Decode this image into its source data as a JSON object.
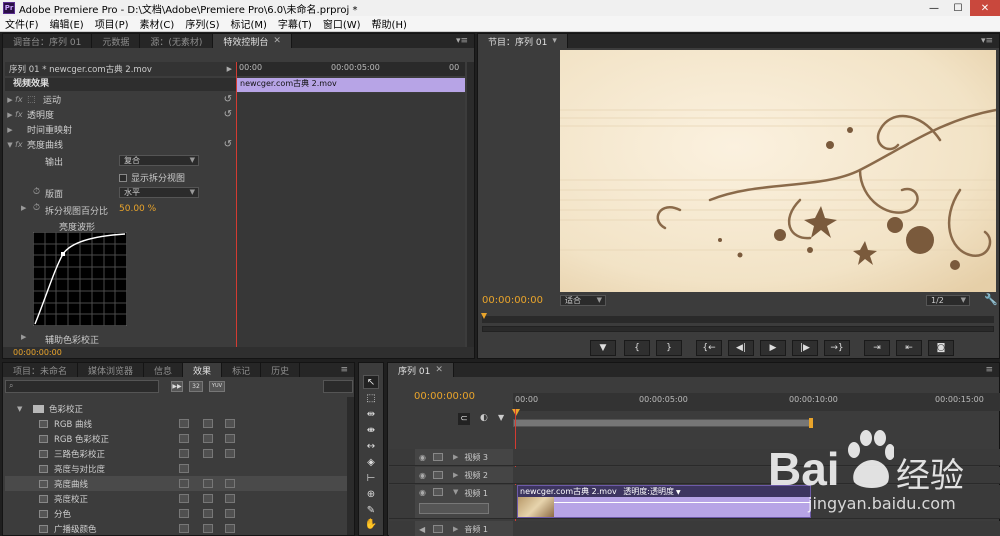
{
  "app": {
    "title": "Adobe Premiere Pro - D:\\文档\\Adobe\\Premiere Pro\\6.0\\未命名.prproj *",
    "logo_text": "Pr"
  },
  "menu": [
    "文件(F)",
    "编辑(E)",
    "项目(P)",
    "素材(C)",
    "序列(S)",
    "标记(M)",
    "字幕(T)",
    "窗口(W)",
    "帮助(H)"
  ],
  "effect_controls": {
    "tabs": [
      "调音台：序列 01",
      "元数据",
      "源：(无素材)",
      "特效控制台"
    ],
    "active_tab": 3,
    "sequence_label": "序列 01 * newcger.com古典 2.mov",
    "ruler": [
      "00:00",
      "00:00:05:00",
      "00"
    ],
    "clip_name": "newcger.com古典 2.mov",
    "section_title": "视频效果",
    "effects": [
      "运动",
      "透明度",
      "时间重映射",
      "亮度曲线"
    ],
    "output_label": "输出",
    "output_value": "复合",
    "split_view_label": "显示拆分视图",
    "layout_label": "版面",
    "layout_value": "水平",
    "split_percent_label": "拆分视图百分比",
    "split_percent_value": "50.00 %",
    "curve_title": "亮度波形",
    "aux_label": "辅助色彩校正",
    "timecode": "00:00:00:00"
  },
  "program": {
    "tab": "节目：序列 01",
    "timecode": "00:00:00:00",
    "fit": "适合",
    "resolution": "1/2",
    "transport": [
      "▼",
      "{",
      "}",
      "{←",
      "◀|",
      "▶",
      "|▶",
      "→}",
      "⇥",
      "⇤",
      "◙"
    ]
  },
  "effects_panel": {
    "tabs": [
      "项目：未命名",
      "媒体浏览器",
      "信息",
      "效果",
      "标记",
      "历史"
    ],
    "active_tab": 3,
    "folder": "色彩校正",
    "badges": [
      "32",
      "YUV"
    ],
    "items": [
      "RGB 曲线",
      "RGB 色彩校正",
      "三路色彩校正",
      "亮度与对比度",
      "亮度曲线",
      "亮度校正",
      "分色",
      "广播级颜色"
    ],
    "selected_index": 4
  },
  "timeline": {
    "tab": "序列 01",
    "timecode": "00:00:00:00",
    "ruler": [
      "00:00",
      "00:00:05:00",
      "00:00:10:00",
      "00:00:15:00"
    ],
    "tracks": [
      "视频 3",
      "视频 2",
      "视频 1",
      "音频 1"
    ],
    "clip_label": "newcger.com古典 2.mov",
    "clip_prop": "透明度:透明度"
  },
  "watermark": {
    "brand": "Bai",
    "brand2": "经验",
    "url": "jingyan.baidu.com"
  },
  "colors": {
    "accent": "#e9a42b",
    "clip": "#b7a4e6",
    "playhead": "#d33b32"
  }
}
